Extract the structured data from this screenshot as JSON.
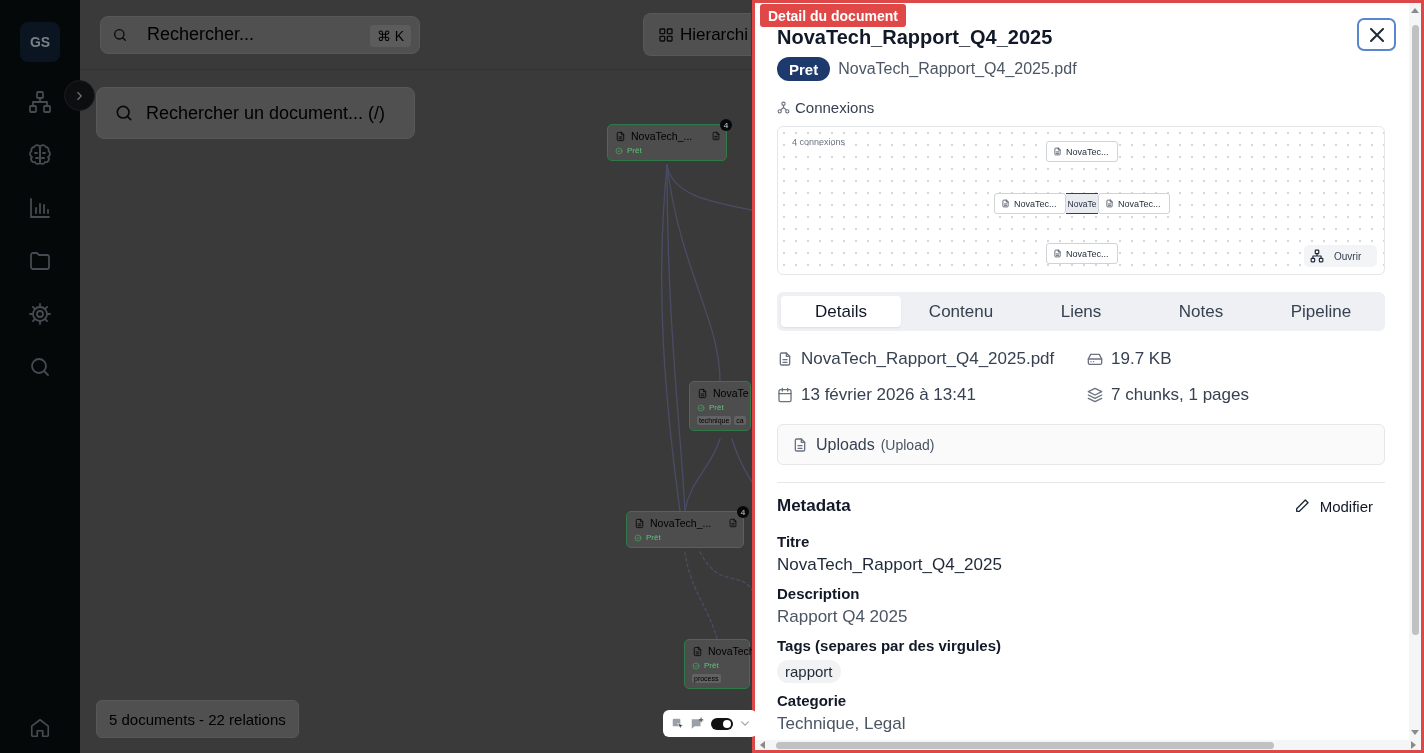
{
  "sidebar": {
    "avatar": "GS"
  },
  "header": {
    "search": {
      "placeholder": "Rechercher...",
      "shortcut": "⌘ K"
    },
    "view_button": "Hierarchi"
  },
  "canvas": {
    "document_search": {
      "placeholder": "Rechercher un document... (/)"
    },
    "nodes": [
      {
        "title": "NovaTech_...",
        "status": "Prêt",
        "badge": "4"
      },
      {
        "title": "NovaTe",
        "status": "Prêt",
        "tags": [
          "technique",
          "ca"
        ]
      },
      {
        "title": "NovaTech_...",
        "status": "Prêt",
        "badge": "4"
      },
      {
        "title": "NovaTech",
        "status": "Prêt",
        "tags": [
          "process"
        ]
      }
    ],
    "stats": "5 documents - 22 relations"
  },
  "widget": {
    "on": true
  },
  "panel": {
    "label": "Detail du document",
    "title": "NovaTech_Rapport_Q4_2025",
    "status": "Pret",
    "filename": "NovaTech_Rapport_Q4_2025.pdf",
    "connections": {
      "heading": "Connexions",
      "count": "4 connexions",
      "center": "NovaTe",
      "nodes": [
        "NovaTec...",
        "NovaTec...",
        "NovaTec...",
        "NovaTec..."
      ],
      "open_button": "Ouvrir"
    },
    "tabs": [
      {
        "label": "Details",
        "selected": true
      },
      {
        "label": "Contenu",
        "selected": false
      },
      {
        "label": "Liens",
        "selected": false
      },
      {
        "label": "Notes",
        "selected": false
      },
      {
        "label": "Pipeline",
        "selected": false
      }
    ],
    "details": {
      "file": "NovaTech_Rapport_Q4_2025.pdf",
      "size": "19.7 KB",
      "date": "13 février 2026 à 13:41",
      "chunks": "7 chunks, 1 pages"
    },
    "source": {
      "name": "Uploads",
      "type": "(Upload)"
    },
    "metadata": {
      "heading": "Metadata",
      "edit_button": "Modifier",
      "fields": [
        {
          "kind": "text",
          "label": "Titre",
          "value": "NovaTech_Rapport_Q4_2025",
          "muted": false
        },
        {
          "kind": "text",
          "label": "Description",
          "value": "Rapport Q4 2025",
          "muted": true
        },
        {
          "kind": "tags",
          "label": "Tags (separes par des virgules)",
          "tags": [
            "rapport"
          ]
        },
        {
          "kind": "text",
          "label": "Categorie",
          "value": "Technique, Legal",
          "muted": true
        }
      ]
    }
  }
}
